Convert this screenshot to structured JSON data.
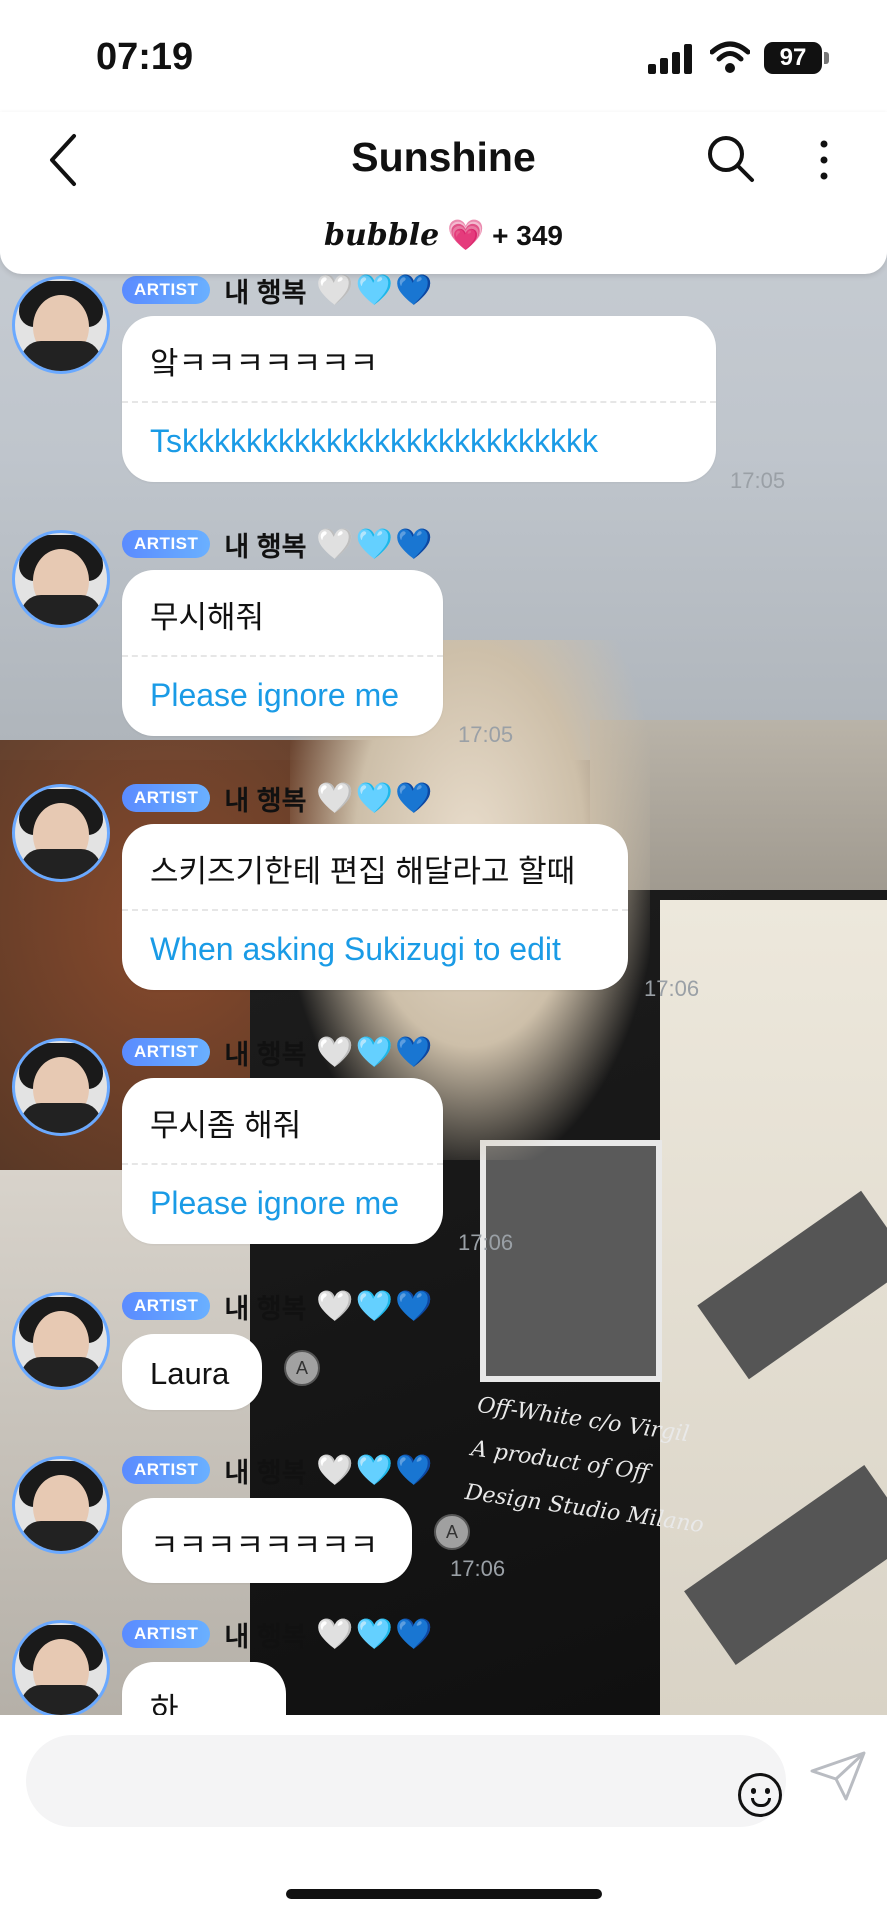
{
  "status": {
    "time": "07:19",
    "battery": "97"
  },
  "header": {
    "title": "Sunshine",
    "brand": "bubble",
    "brand_heart": "💗",
    "count": "+ 349"
  },
  "messages": [
    {
      "badge": "ARTIST",
      "nickname": "내 행복",
      "hearts": "🤍🩵💙",
      "original": "앜ㅋㅋㅋㅋㅋㅋㅋ",
      "translation": "Tskkkkkkkkkkkkkkkkkkkkkkkkkk",
      "time": "17:05"
    },
    {
      "badge": "ARTIST",
      "nickname": "내 행복",
      "hearts": "🤍🩵💙",
      "original": "무시해줘",
      "translation": "Please ignore me",
      "time": "17:05"
    },
    {
      "badge": "ARTIST",
      "nickname": "내 행복",
      "hearts": "🤍🩵💙",
      "original": "스키즈기한테 편집 해달라고 할때",
      "translation": "When asking Sukizugi to edit",
      "time": "17:06"
    },
    {
      "badge": "ARTIST",
      "nickname": "내 행복",
      "hearts": "🤍🩵💙",
      "original": "무시좀 해줘",
      "translation": "Please ignore me",
      "time": "17:06"
    },
    {
      "badge": "ARTIST",
      "nickname": "내 행복",
      "hearts": "🤍🩵💙",
      "original": "Laura",
      "time": ""
    },
    {
      "badge": "ARTIST",
      "nickname": "내 행복",
      "hearts": "🤍🩵💙",
      "original": "ㅋㅋㅋㅋㅋㅋㅋㅋ",
      "time": "17:06"
    },
    {
      "badge": "ARTIST",
      "nickname": "내 행복",
      "hearts": "🤍🩵💙",
      "original": "하..",
      "time": ""
    }
  ],
  "background_text": [
    "Off-White c/o Virgil",
    "A product of Off",
    "Design Studio Milano"
  ],
  "translate_icon_label": "A",
  "icons": {
    "back": "chevron-left-icon",
    "search": "search-icon",
    "more": "more-vertical-icon",
    "emoji": "emoji-icon",
    "send": "send-icon"
  }
}
